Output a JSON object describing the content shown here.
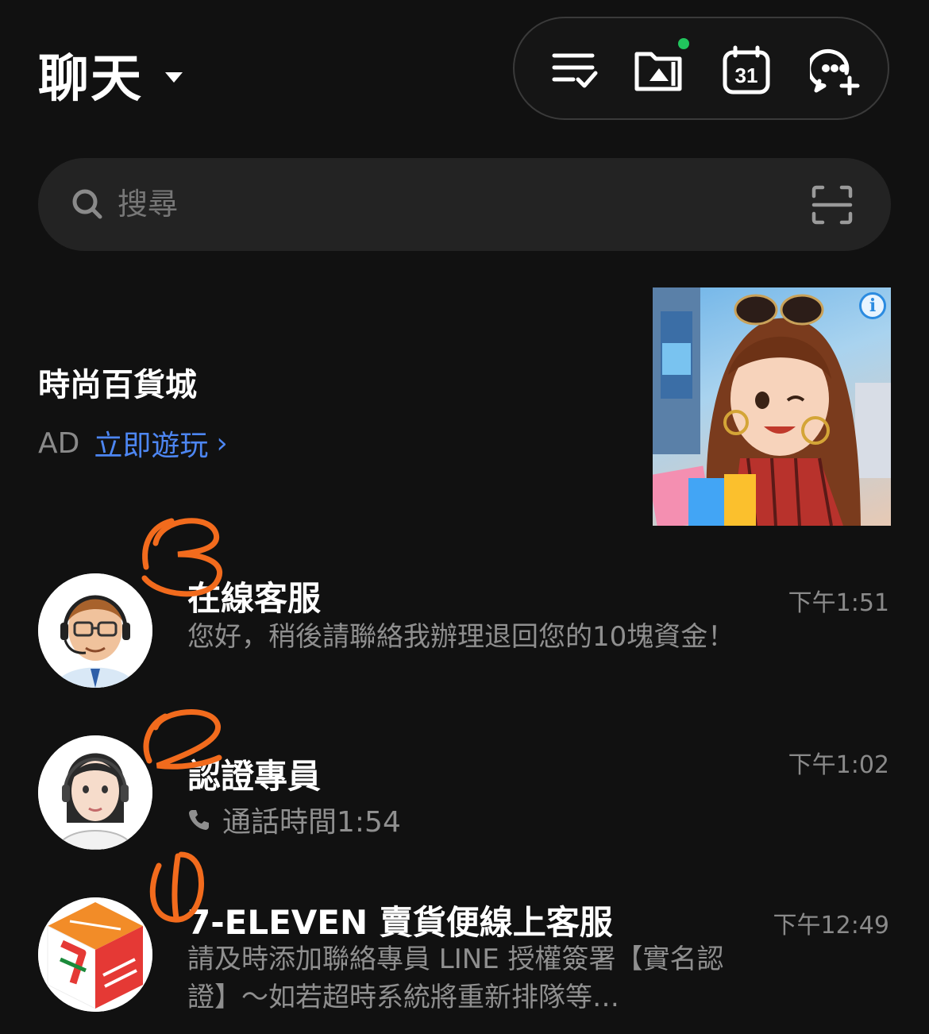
{
  "header": {
    "title": "聊天",
    "calendar_day": "31"
  },
  "search": {
    "placeholder": "搜尋"
  },
  "ad": {
    "title": "時尚百貨城",
    "tag": "AD",
    "cta_label": "立即遊玩",
    "cta_arrow": "›",
    "info_glyph": "i"
  },
  "chats": [
    {
      "name": "在線客服",
      "time": "下午1:51",
      "message": "您好，稍後請聯絡我辦理退回您的10塊資金！",
      "annotation": "3"
    },
    {
      "name": "認證專員",
      "time": "下午1:02",
      "message": "通話時間1:54",
      "annotation": "2"
    },
    {
      "name": "7-ELEVEN 賣貨便線上客服",
      "time": "下午12:49",
      "message": "請及時添加聯絡專員 LINE 授權簽署【實名認證】～如若超時系統將重新排隊等…",
      "annotation": "1"
    }
  ],
  "colors": {
    "background": "#111111",
    "accent_link": "#4d86f2",
    "notification_dot": "#21c55d",
    "annotation": "#f26b1d",
    "secondary_text": "#8f8f8f"
  }
}
